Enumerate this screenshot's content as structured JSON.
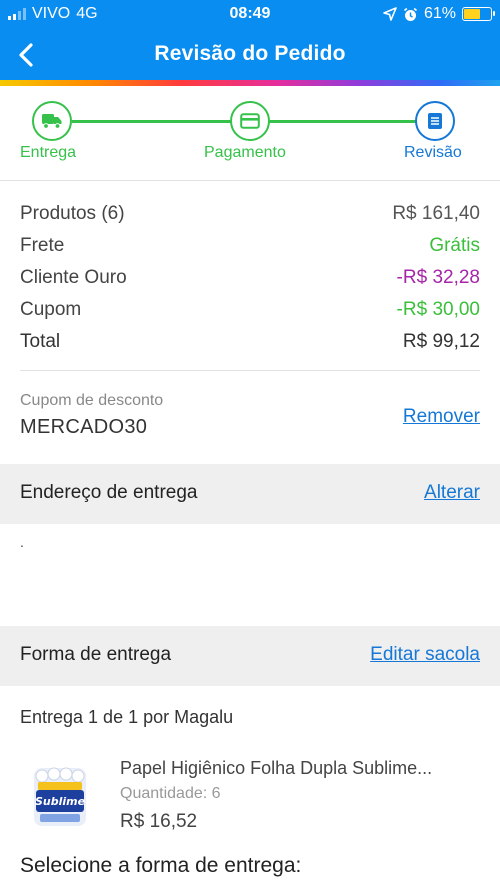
{
  "status_bar": {
    "carrier": "VIVO",
    "network": "4G",
    "time": "08:49",
    "battery": "61%",
    "battery_level": 0.61,
    "icons": [
      "signal-icon",
      "location-arrow-icon",
      "alarm-icon",
      "battery-icon"
    ]
  },
  "header": {
    "title": "Revisão do Pedido",
    "back_icon": "chevron-left-icon"
  },
  "stepper": {
    "steps": [
      {
        "label": "Entrega",
        "icon": "truck-icon",
        "state": "done"
      },
      {
        "label": "Pagamento",
        "icon": "credit-card-icon",
        "state": "done"
      },
      {
        "label": "Revisão",
        "icon": "document-icon",
        "state": "current"
      }
    ]
  },
  "summary": {
    "rows": [
      {
        "label": "Produtos (6)",
        "value": "R$ 161,40"
      },
      {
        "label": "Frete",
        "value": "Grátis"
      },
      {
        "label": "Cliente Ouro",
        "value": "-R$ 32,28"
      },
      {
        "label": "Cupom",
        "value": "-R$ 30,00"
      },
      {
        "label": "Total",
        "value": "R$ 99,12"
      }
    ]
  },
  "coupon": {
    "label": "Cupom de desconto",
    "code": "MERCADO30",
    "remove_label": "Remover"
  },
  "address": {
    "title": "Endereço de entrega",
    "edit_label": "Alterar",
    "text": "."
  },
  "shipping": {
    "title": "Forma de entrega",
    "edit_label": "Editar sacola",
    "delivery_prefix": "Entrega 1 de 1",
    "delivery_by": " por Magalu"
  },
  "product": {
    "name": "Papel Higiênico Folha Dupla Sublime...",
    "quantity": "Quantidade: 6",
    "price": "R$ 16,52",
    "brand_text": "Sublime"
  },
  "choose_shipping": {
    "title": "Selecione a forma de entrega:"
  },
  "colors": {
    "primary": "#0a8df0",
    "link": "#1578d6",
    "success": "#36c24a",
    "discount": "#a526a8"
  }
}
